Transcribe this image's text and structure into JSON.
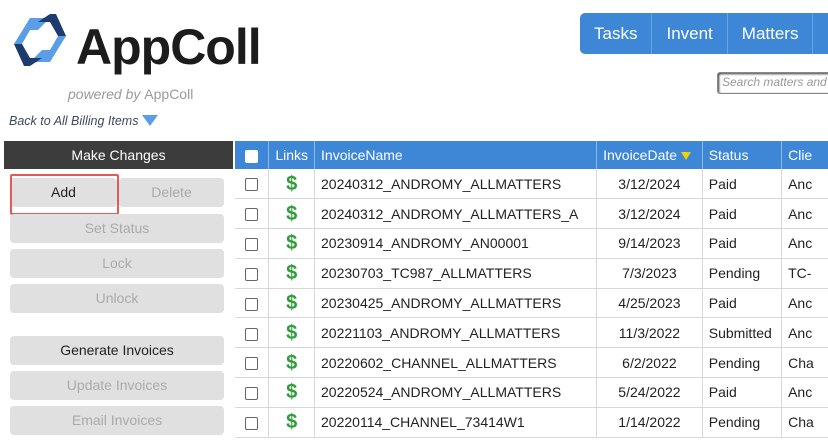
{
  "brand": {
    "name": "AppColl",
    "powered_prefix": "powered by",
    "powered_name": "AppColl"
  },
  "back_link": "Back to All Billing Items",
  "nav": [
    "Tasks",
    "Invent",
    "Matters"
  ],
  "search": {
    "placeholder": "Search matters and"
  },
  "panel": {
    "title": "Make Changes",
    "buttons": {
      "add": "Add",
      "delete": "Delete",
      "set_status": "Set Status",
      "lock": "Lock",
      "unlock": "Unlock",
      "generate": "Generate Invoices",
      "update": "Update Invoices",
      "email": "Email Invoices"
    }
  },
  "table": {
    "headers": {
      "links": "Links",
      "name": "InvoiceName",
      "date": "InvoiceDate",
      "status": "Status",
      "client": "Clie"
    },
    "rows": [
      {
        "name": "20240312_ANDROMY_ALLMATTERS",
        "date": "3/12/2024",
        "status": "Paid",
        "client": "Anc"
      },
      {
        "name": "20240312_ANDROMY_ALLMATTERS_A",
        "date": "3/12/2024",
        "status": "Paid",
        "client": "Anc"
      },
      {
        "name": "20230914_ANDROMY_AN00001",
        "date": "9/14/2023",
        "status": "Paid",
        "client": "Anc"
      },
      {
        "name": "20230703_TC987_ALLMATTERS",
        "date": "7/3/2023",
        "status": "Pending",
        "client": "TC-"
      },
      {
        "name": "20230425_ANDROMY_ALLMATTERS",
        "date": "4/25/2023",
        "status": "Paid",
        "client": "Anc"
      },
      {
        "name": "20221103_ANDROMY_ALLMATTERS",
        "date": "11/3/2022",
        "status": "Submitted",
        "client": "Anc"
      },
      {
        "name": "20220602_CHANNEL_ALLMATTERS",
        "date": "6/2/2022",
        "status": "Pending",
        "client": "Cha"
      },
      {
        "name": "20220524_ANDROMY_ALLMATTERS",
        "date": "5/24/2022",
        "status": "Paid",
        "client": "Anc"
      },
      {
        "name": "20220114_CHANNEL_73414W1",
        "date": "1/14/2022",
        "status": "Pending",
        "client": "Cha"
      }
    ],
    "link_symbol": "$"
  },
  "colors": {
    "accent": "#3d87d6",
    "panel_header": "#3c3c3c",
    "link_green": "#2e9e3a",
    "highlight": "#e25b5b"
  }
}
